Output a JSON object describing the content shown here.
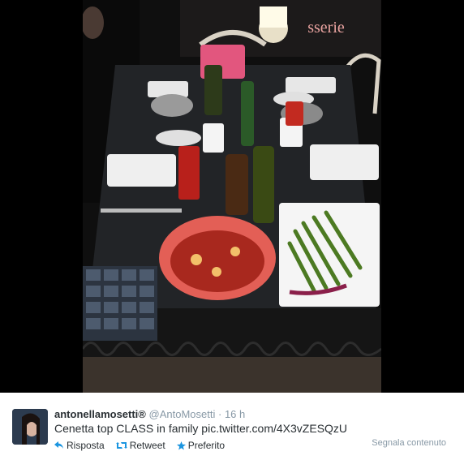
{
  "media": {
    "sign_text": "sserie"
  },
  "tweet": {
    "fullname": "antonellamosetti®",
    "username": "@AntoMosetti",
    "separator": "·",
    "time": "16 h",
    "text": "Cenetta top CLASS in family pic.twitter.com/4X3vZESQzU",
    "actions": {
      "reply": "Risposta",
      "retweet": "Retweet",
      "favorite": "Preferito"
    },
    "report": "Segnala contenuto"
  },
  "colors": {
    "accent": "#1b95e0",
    "meta_gray": "#8899a6",
    "text": "#292f33"
  }
}
